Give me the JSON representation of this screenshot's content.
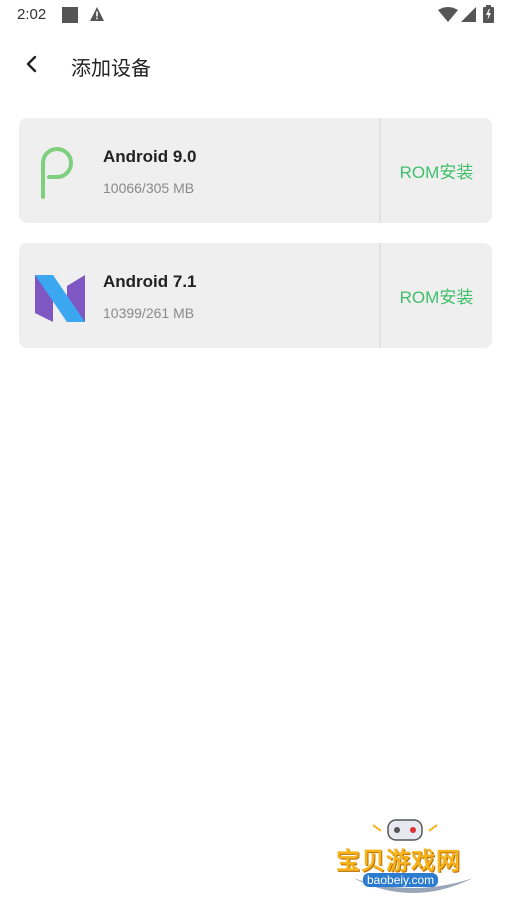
{
  "statusbar": {
    "time": "2:02",
    "icons": [
      "notification-square-icon",
      "warning-icon",
      "wifi-icon",
      "cell-signal-icon",
      "battery-icon"
    ]
  },
  "appbar": {
    "back_icon": "back-arrow-icon",
    "title": "添加设备"
  },
  "devices": [
    {
      "name": "Android 9.0",
      "size": "10066/305 MB",
      "action": "ROM安装",
      "logo": "android-pie-logo"
    },
    {
      "name": "Android 7.1",
      "size": "10399/261 MB",
      "action": "ROM安装",
      "logo": "android-nougat-logo"
    }
  ],
  "watermark": {
    "text": "宝贝游戏网",
    "url": "baobeiy.com"
  },
  "colors": {
    "accent": "#3fbf6a",
    "card_bg": "#efefef",
    "pie_green": "#7ed07e",
    "nougat_purple": "#7e57c2",
    "nougat_blue": "#3aa7f0"
  }
}
